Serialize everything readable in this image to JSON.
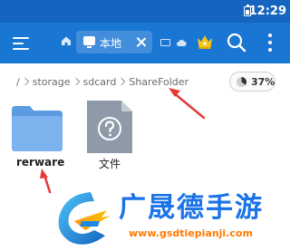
{
  "status_bar": {
    "time": "12:29"
  },
  "toolbar": {
    "tab_label": "本地"
  },
  "breadcrumb": {
    "root": "/",
    "segments": [
      "storage",
      "sdcard",
      "ShareFolder"
    ]
  },
  "storage": {
    "percent": "37%"
  },
  "files": [
    {
      "name": "rerware",
      "type": "folder"
    },
    {
      "name": "文件",
      "type": "unknown-file"
    }
  ],
  "watermark": {
    "title": "广晟德手游",
    "url": "www.gsdtiepianji.com"
  },
  "colors": {
    "status_bar": "#1565c0",
    "toolbar": "#1976d2",
    "folder": "#6aa6e6",
    "annotation": "#e53935"
  },
  "icons": [
    "menu-icon",
    "home-icon",
    "tablet-icon",
    "close-icon",
    "crown-icon",
    "search-icon",
    "more-icon",
    "pie-chart-icon",
    "folder-icon",
    "question-icon"
  ]
}
